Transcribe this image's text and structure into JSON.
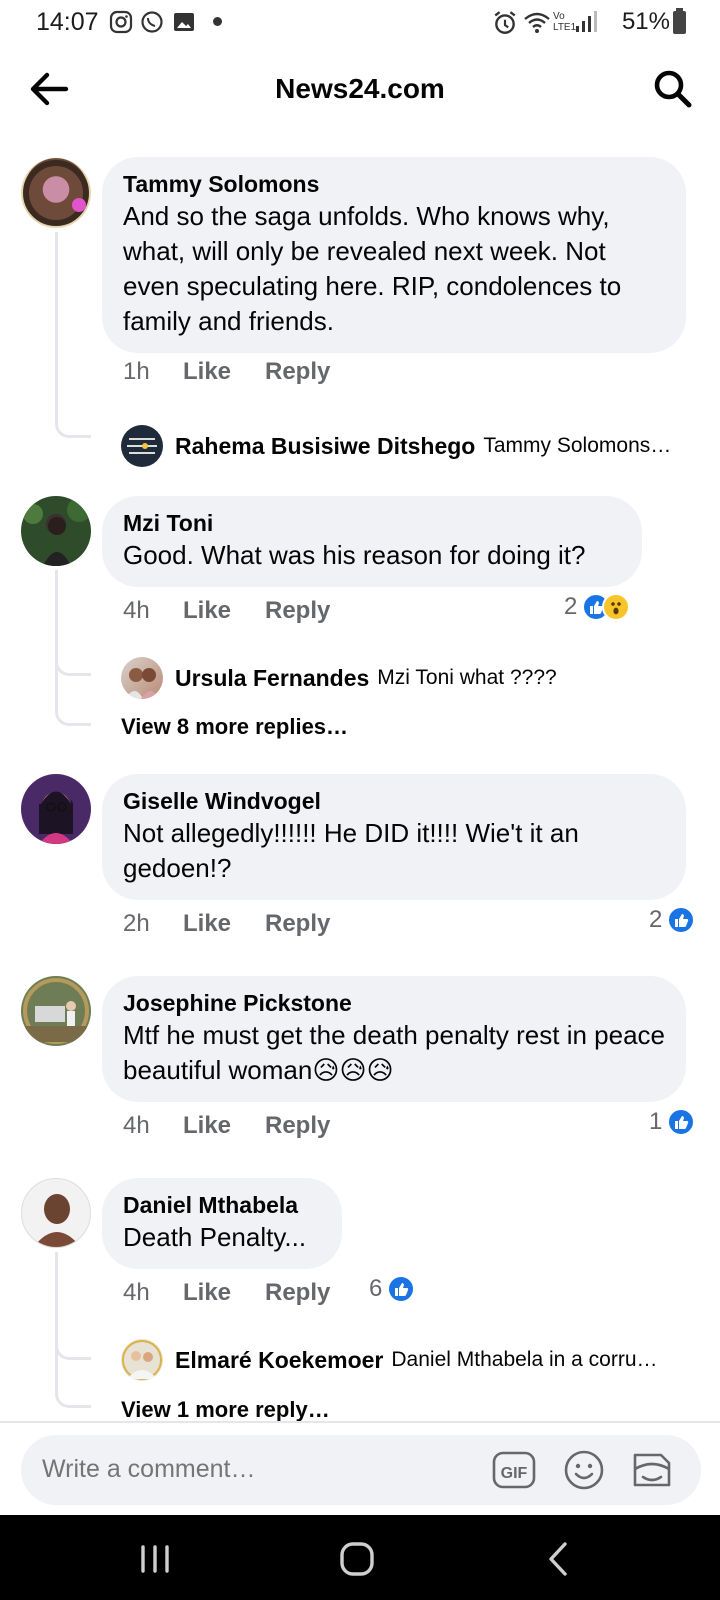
{
  "status_bar": {
    "time": "14:07",
    "battery": "51%",
    "network": "Vo LTE1"
  },
  "header": {
    "title": "News24.com"
  },
  "comments": [
    {
      "author": "Tammy Solomons",
      "text": "And so the saga unfolds. Who knows why, what, will only be revealed next week. Not even speculating here. RIP, condolences to family and friends.",
      "time": "1h",
      "like": "Like",
      "reply": "Reply",
      "replies": [
        {
          "author": "Rahema Busisiwe Ditshego",
          "text": "Tammy Solomons…"
        }
      ]
    },
    {
      "author": "Mzi Toni",
      "text": "Good. What was his reason for doing it?",
      "time": "4h",
      "like": "Like",
      "reply": "Reply",
      "reaction_count": "2",
      "replies": [
        {
          "author": "Ursula Fernandes",
          "text": "Mzi Toni  what ????"
        }
      ],
      "view_more": "View 8 more replies…"
    },
    {
      "author": "Giselle Windvogel",
      "text": "Not allegedly!!!!!! He DID it!!!! Wie't it an gedoen!?",
      "time": "2h",
      "like": "Like",
      "reply": "Reply",
      "reaction_count": "2"
    },
    {
      "author": "Josephine Pickstone",
      "text": "Mtf he must get the death penalty rest in peace beautiful woman😥😥😥",
      "time": "4h",
      "like": "Like",
      "reply": "Reply",
      "reaction_count": "1"
    },
    {
      "author": "Daniel Mthabela",
      "text": "Death Penalty...",
      "time": "4h",
      "like": "Like",
      "reply": "Reply",
      "reaction_count": "6",
      "replies": [
        {
          "author": "Elmaré Koekemoer",
          "text": "Daniel Mthabela in a corru…"
        }
      ],
      "view_more": "View 1 more reply…"
    }
  ],
  "composer": {
    "placeholder": "Write a comment…",
    "gif_label": "GIF"
  },
  "colors": {
    "accent": "#1b74e4",
    "bubble": "#f0f2f5",
    "secondary_text": "#65676b"
  }
}
